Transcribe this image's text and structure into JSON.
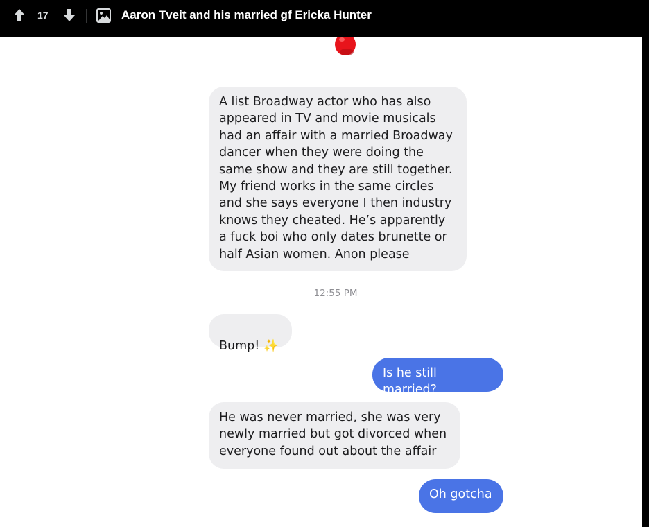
{
  "header": {
    "score": "17",
    "title": "Aaron Tveit and his married gf Ericka Hunter",
    "upvote_icon": "arrow-up-icon",
    "downvote_icon": "arrow-down-icon",
    "post_type_icon": "image-icon"
  },
  "conversation": {
    "messages": [
      {
        "from": "them",
        "text": "A list Broadway actor who has also\nappeared in TV and movie musicals\nhad an affair with a  married Broadway\ndancer when they were doing the\nsame show and they are still together.\nMy friend works in the same circles\nand she says everyone I then industry\nknows they cheated. He’s apparently\na fuck boi who only dates brunette or\nhalf Asian women. Anon please"
      },
      {
        "from": "them",
        "text": "Bump!",
        "emoji": "✨"
      },
      {
        "from": "me",
        "text": "Is he still married?"
      },
      {
        "from": "them",
        "text": "He was never married, she was very\nnewly married but got divorced when\neveryone found out about the affair"
      },
      {
        "from": "me",
        "text": "Oh gotcha"
      }
    ],
    "timestamp": "12:55 PM"
  },
  "colors": {
    "sent_bubble": "#4a74e6",
    "received_bubble": "#eeeef0",
    "balloon": "#e8141b"
  }
}
